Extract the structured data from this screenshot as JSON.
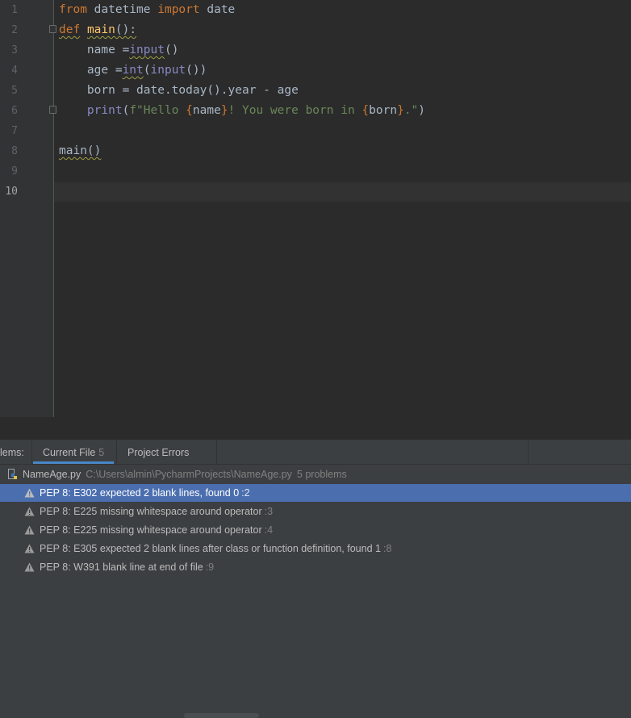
{
  "editor": {
    "line_numbers": [
      "1",
      "2",
      "3",
      "4",
      "5",
      "6",
      "7",
      "8",
      "9",
      "10"
    ],
    "current_line": "10",
    "code": {
      "l1": {
        "kw1": "from",
        "mod": " datetime ",
        "kw2": "import",
        "name": " date"
      },
      "l2": {
        "kw": "def",
        "sp": " ",
        "fn": "main",
        "rest": "():"
      },
      "l3": {
        "pre": "    name =",
        "bi": "input",
        "post": "()"
      },
      "l4": {
        "pre": "    age =",
        "bi1": "int",
        "mid": "(",
        "bi2": "input",
        "post": "())"
      },
      "l5": {
        "text": "    born = date.today().year - age"
      },
      "l6": {
        "pre": "    ",
        "bi": "print",
        "open": "(",
        "s1": "f\"Hello ",
        "b1": "{",
        "v1": "name",
        "b2": "}",
        "s2": "! You were born in ",
        "b3": "{",
        "v2": "born",
        "b4": "}",
        "s3": ".\"",
        "close": ")"
      },
      "l8": {
        "text": "main()"
      }
    }
  },
  "problems": {
    "tabs_label": "lems:",
    "tabs": [
      {
        "label": "Current File",
        "count": "5"
      },
      {
        "label": "Project Errors",
        "count": ""
      }
    ],
    "file": {
      "icon": "python-file-icon",
      "name": "NameAge.py",
      "path": "C:\\Users\\almin\\PycharmProjects\\NameAge.py",
      "count": "5 problems"
    },
    "items": [
      {
        "text": "PEP 8: E302 expected 2 blank lines, found 0",
        "line": ":2"
      },
      {
        "text": "PEP 8: E225 missing whitespace around operator",
        "line": ":3"
      },
      {
        "text": "PEP 8: E225 missing whitespace around operator",
        "line": ":4"
      },
      {
        "text": "PEP 8: E305 expected 2 blank lines after class or function definition, found 1",
        "line": ":8"
      },
      {
        "text": "PEP 8: W391 blank line at end of file",
        "line": ":9"
      }
    ],
    "selected_index": 0
  },
  "colors": {
    "editor_bg": "#2b2b2b",
    "keyword": "#cc7832",
    "function": "#ffc66d",
    "builtin": "#8888c6",
    "string": "#6a8759",
    "selection": "#4b6eaf",
    "warning": "#9e9e44"
  }
}
